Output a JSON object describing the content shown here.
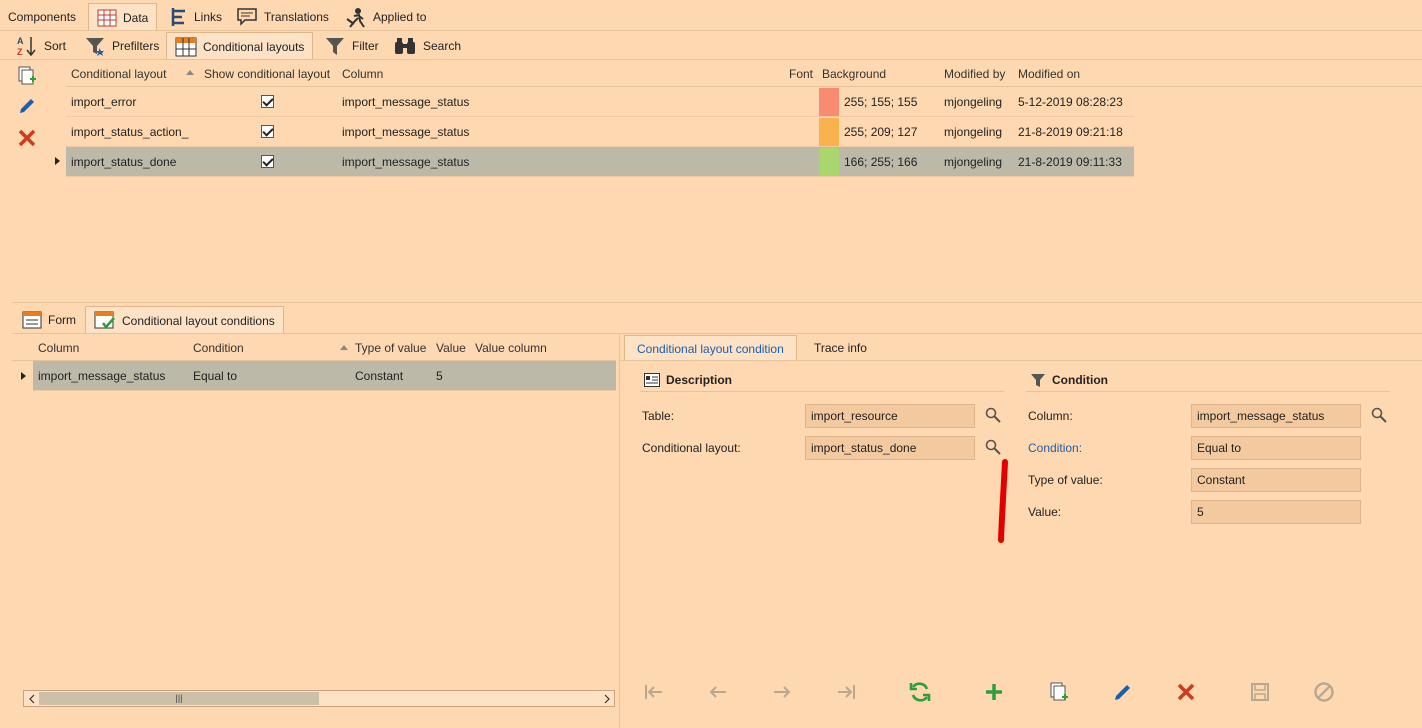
{
  "top_tabs": [
    "Components",
    "Data",
    "Links",
    "Translations",
    "Applied to"
  ],
  "sub_tabs": [
    "Sort",
    "Prefilters",
    "Conditional layouts",
    "Filter",
    "Search"
  ],
  "grid": {
    "headers": [
      "Conditional layout",
      "Show conditional layout",
      "Column",
      "Font",
      "Background",
      "Modified by",
      "Modified on"
    ],
    "rows": [
      {
        "layout": "import_error",
        "column": "import_message_status",
        "bg_text": "255; 155; 155",
        "bg_color": "#f98b71",
        "modified_by": "mjongeling",
        "modified_on": "5-12-2019 08:28:23"
      },
      {
        "layout": "import_status_action_",
        "column": "import_message_status",
        "bg_text": "255; 209; 127",
        "bg_color": "#fab24f",
        "modified_by": "mjongeling",
        "modified_on": "21-8-2019 09:21:18"
      },
      {
        "layout": "import_status_done",
        "column": "import_message_status",
        "bg_text": "166; 255; 166",
        "bg_color": "#a9d66d",
        "modified_by": "mjongeling",
        "modified_on": "21-8-2019 09:11:33"
      }
    ]
  },
  "bottom_tabs": [
    "Form",
    "Conditional layout conditions"
  ],
  "cond_grid": {
    "headers": [
      "Column",
      "Condition",
      "Type of value",
      "Value",
      "Value column"
    ],
    "row": {
      "column": "import_message_status",
      "condition": "Equal to",
      "type": "Constant",
      "value": "5"
    }
  },
  "detail_tabs": [
    "Conditional layout condition",
    "Trace info"
  ],
  "description": {
    "title": "Description",
    "table_label": "Table:",
    "table_value": "import_resource",
    "layout_label": "Conditional layout:",
    "layout_value": "import_status_done"
  },
  "condition": {
    "title": "Condition",
    "column_label": "Column:",
    "column_value": "import_message_status",
    "condition_label": "Condition:",
    "condition_value": "Equal to",
    "type_label": "Type of value:",
    "type_value": "Constant",
    "value_label": "Value:",
    "value_value": "5"
  },
  "scroll_glyph": "|||"
}
